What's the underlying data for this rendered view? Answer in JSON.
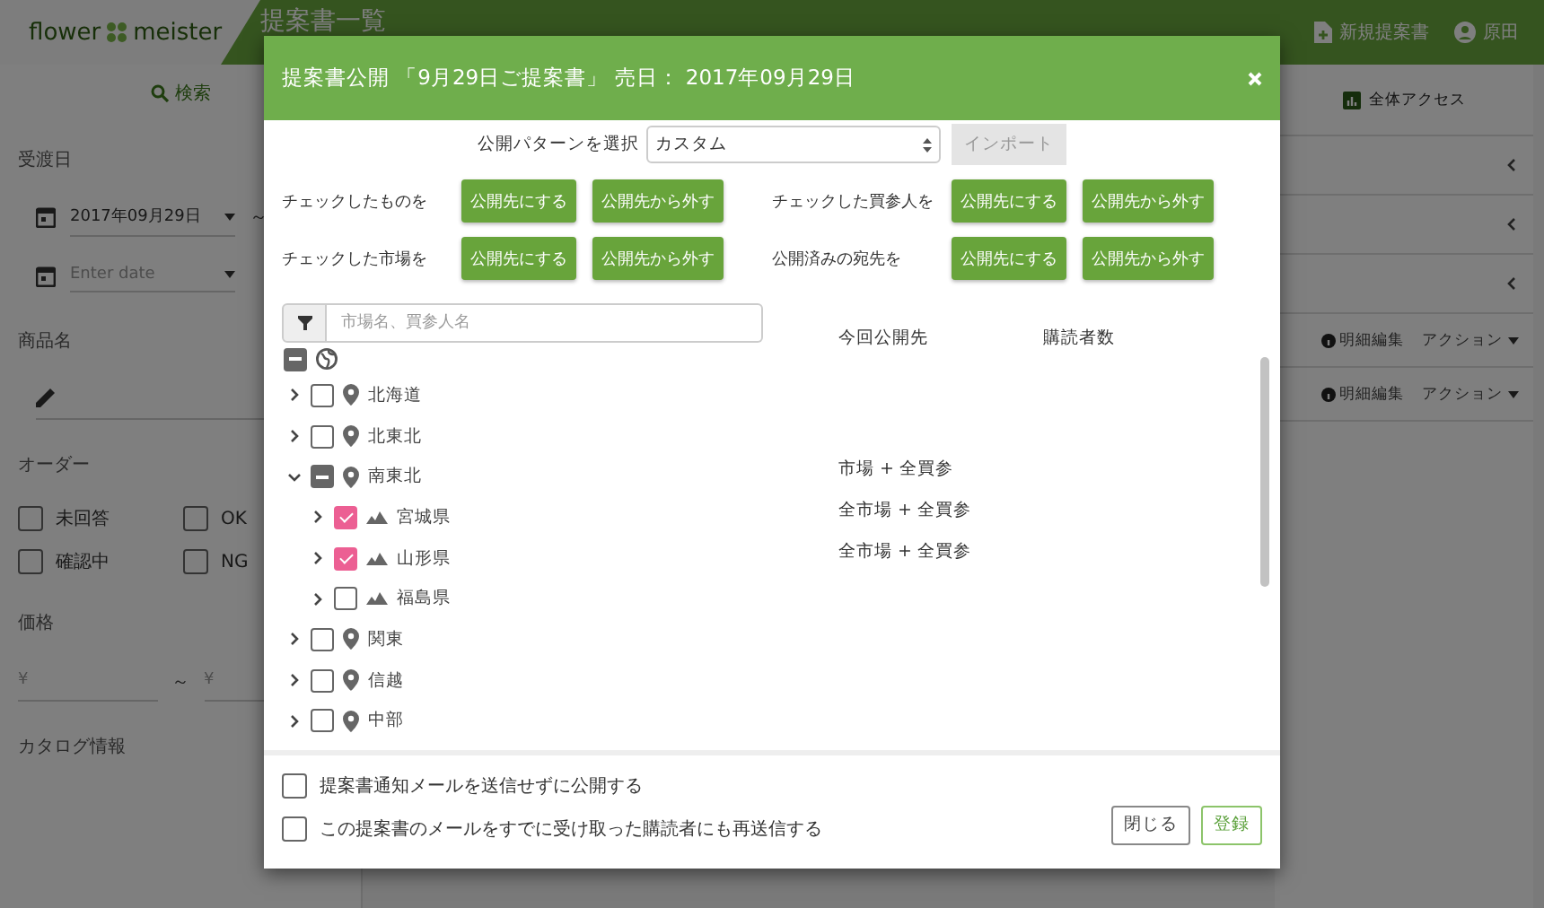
{
  "header": {
    "logo_left": "flower",
    "logo_right": "meister",
    "title": "提案書一覧",
    "new_button": "新規提案書",
    "user": "原田"
  },
  "sidebar": {
    "search_button": "検索",
    "date_label": "受渡日",
    "date_from": "2017年09月29日",
    "range_sep": "～",
    "date_to_placeholder": "Enter date",
    "product_label": "商品名",
    "order_label": "オーダー",
    "order_options": [
      {
        "label": "未回答",
        "checked": false
      },
      {
        "label": "OK",
        "checked": false
      },
      {
        "label": "確認中",
        "checked": false
      },
      {
        "label": "NG",
        "checked": false
      }
    ],
    "price_label": "価格",
    "price_from_placeholder": "¥",
    "price_sep": "～",
    "price_to_placeholder": "¥",
    "catalog_label": "カタログ情報"
  },
  "right_panel": {
    "access_button": "全体アクセス",
    "sections": [
      {
        "expanded": false
      },
      {
        "expanded": false
      },
      {
        "expanded": false
      }
    ],
    "rows": [
      {
        "edit": "明細編集",
        "action": "アクション"
      },
      {
        "edit": "明細編集",
        "action": "アクション"
      }
    ]
  },
  "dialog": {
    "title": "提案書公開 「9月29日ご提案書」 売日： 2017年09月29日",
    "pattern_label": "公開パターンを選択",
    "pattern_value": "カスタム",
    "import_button": {
      "label": "インポート",
      "disabled": true
    },
    "bulk_actions": [
      {
        "label": "チェックしたものを",
        "buttons": [
          "公開先にする",
          "公開先から外す"
        ]
      },
      {
        "label": "チェックした買参人を",
        "buttons": [
          "公開先にする",
          "公開先から外す"
        ]
      },
      {
        "label": "チェックした市場を",
        "buttons": [
          "公開先にする",
          "公開先から外す"
        ]
      },
      {
        "label": "公開済みの宛先を",
        "buttons": [
          "公開先にする",
          "公開先から外す"
        ]
      }
    ],
    "filter_placeholder": "市場名、買参人名",
    "columns": [
      "今回公開先",
      "購読者数"
    ],
    "root": {
      "checked": false,
      "indeterminate": true
    },
    "tree": [
      {
        "label": "北海道",
        "kind": "region",
        "checked": false,
        "indeterminate": false,
        "expanded": false
      },
      {
        "label": "北東北",
        "kind": "region",
        "checked": false,
        "indeterminate": false,
        "expanded": false
      },
      {
        "label": "南東北",
        "kind": "region",
        "checked": false,
        "indeterminate": true,
        "expanded": true,
        "target": "市場 + 全買参",
        "children": [
          {
            "label": "宮城県",
            "kind": "prefecture",
            "checked": true,
            "indeterminate": false,
            "expanded": false,
            "target": "全市場 + 全買参"
          },
          {
            "label": "山形県",
            "kind": "prefecture",
            "checked": true,
            "indeterminate": false,
            "expanded": false,
            "target": "全市場 + 全買参"
          },
          {
            "label": "福島県",
            "kind": "prefecture",
            "checked": false,
            "indeterminate": false,
            "expanded": false
          }
        ]
      },
      {
        "label": "関東",
        "kind": "region",
        "checked": false,
        "indeterminate": false,
        "expanded": false
      },
      {
        "label": "信越",
        "kind": "region",
        "checked": false,
        "indeterminate": false,
        "expanded": false
      },
      {
        "label": "中部",
        "kind": "region",
        "checked": false,
        "indeterminate": false,
        "expanded": false
      }
    ],
    "options": [
      {
        "label": "提案書通知メールを送信せずに公開する",
        "checked": false
      },
      {
        "label": "この提案書のメールをすでに受け取った購読者にも再送信する",
        "checked": false
      }
    ],
    "close_button": "閉じる",
    "submit_button": "登録"
  }
}
